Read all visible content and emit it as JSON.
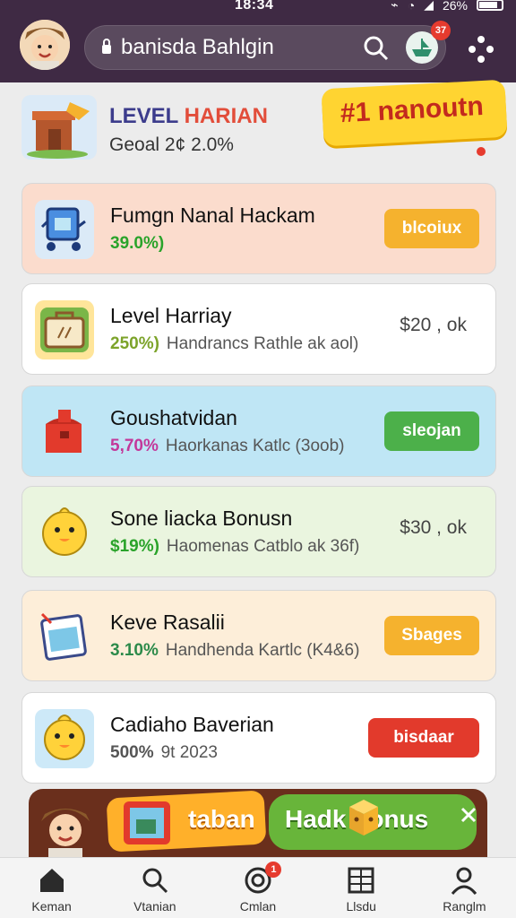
{
  "status": {
    "time": "18:34",
    "battery": "26%"
  },
  "header": {
    "search_text": "banisda Bahlgin",
    "notification_count": "37"
  },
  "level": {
    "title_part1": "LEVEL",
    "title_part2": "HARIAN",
    "goal": "Geoal 2¢ 2.0%",
    "promo": "#1 nanoutn"
  },
  "rows": [
    {
      "title": "Fumgn Nanal Hackam",
      "pct": "39.0%)",
      "desc": "",
      "action": "blcoiux",
      "price": "",
      "bg": "#fbdccd",
      "icon_bg": "#dbeaf7",
      "pct_color": "#2aa32a",
      "btn_color": "#f5b22e"
    },
    {
      "title": "Level Harriay",
      "pct": "250%)",
      "desc": "Handrancs Rathle ak aol)",
      "action": "",
      "price": "$20 , ok",
      "bg": "#ffffff",
      "icon_bg": "#ffe59a",
      "pct_color": "#7ca32a",
      "btn_color": ""
    },
    {
      "title": "Goushatvidan",
      "pct": "5,70%",
      "desc": "Haorkanas Katlc (3oob)",
      "action": "sleojan",
      "price": "",
      "bg": "#bfe6f5",
      "icon_bg": "#bfe6f5",
      "pct_color": "#c3389a",
      "btn_color": "#4cb04a"
    },
    {
      "title": "Sone liacka Bonusn",
      "pct": "$19%)",
      "desc": "Haomenas Catblo ak 36f)",
      "action": "",
      "price": "$30 , ok",
      "bg": "#eaf5df",
      "icon_bg": "#eaf5df",
      "pct_color": "#2aa32a",
      "btn_color": ""
    },
    {
      "title": "Keve Rasalii",
      "pct": "3.10%",
      "desc": "Handhenda Kartlc (K4&6)",
      "action": "Sbages",
      "price": "",
      "bg": "#fdeed9",
      "icon_bg": "#fdeed9",
      "pct_color": "#2c8a4a",
      "btn_color": "#f5b22e"
    },
    {
      "title": "Cadiaho Baverian",
      "pct": "500%",
      "desc": "9t 2023",
      "action": "bisdaar",
      "price": "",
      "bg": "#ffffff",
      "icon_bg": "#cde9f8",
      "pct_color": "#555555",
      "btn_color": "#e23a2c"
    }
  ],
  "banner": {
    "left_text": "taban",
    "right_text": "Hadk   bonus"
  },
  "nav": [
    {
      "label": "Keman",
      "icon": "home-icon"
    },
    {
      "label": "Vtanian",
      "icon": "search-icon"
    },
    {
      "label": "Cmlan",
      "icon": "target-icon",
      "badge": "1"
    },
    {
      "label": "Llsdu",
      "icon": "grid-icon"
    },
    {
      "label": "Ranglm",
      "icon": "profile-icon"
    }
  ]
}
